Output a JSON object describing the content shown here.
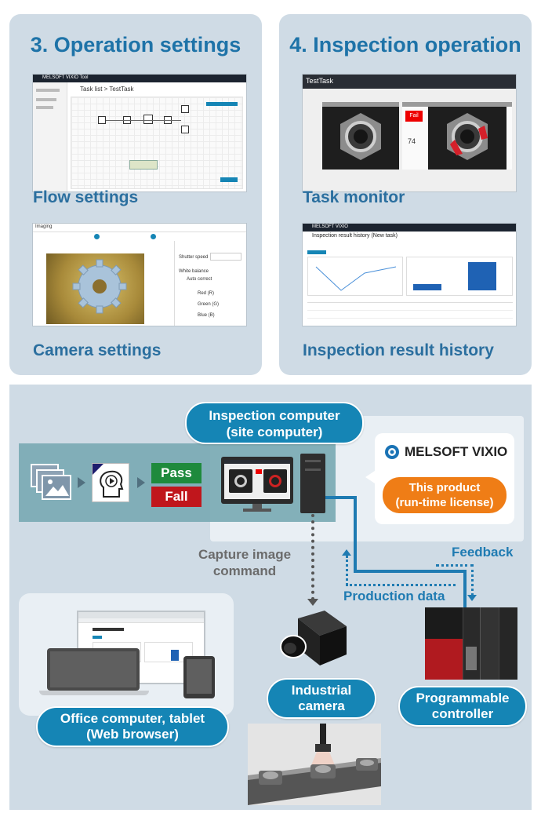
{
  "panels": {
    "operation_settings": {
      "title": "3. Operation settings",
      "flow_label": "Flow settings",
      "camera_label": "Camera settings",
      "flow_screen": {
        "app_name": "MELSOFT VIXIO Tool",
        "breadcrumb": "Task list  >  TestTask"
      },
      "camera_screen": {
        "title": "Imaging",
        "shutter_label": "Shutter speed",
        "white_balance": "White balance",
        "auto_correct": "Auto correct",
        "red": "Red (R)",
        "green": "Green (G)",
        "blue": "Blue (B)"
      }
    },
    "inspection_operation": {
      "title": "4. Inspection operation",
      "monitor_label": "Task monitor",
      "history_label": "Inspection result history",
      "monitor_screen": {
        "task_name": "TestTask",
        "fail_badge": "Fail",
        "score": "74"
      },
      "history_screen": {
        "app_name": "MELSOFT VIXIO",
        "title": "Inspection result history (New task)"
      }
    }
  },
  "system": {
    "inspection_computer": "Inspection computer\n(site computer)",
    "pass": "Pass",
    "fail": "Fall",
    "brand": "MELSOFT VIXIO",
    "license": "This product\n(run-time license)",
    "capture_command": "Capture image\ncommand",
    "feedback": "Feedback",
    "production_data": "Production data",
    "industrial_camera": "Industrial\ncamera",
    "plc": "Programmable\ncontroller",
    "office": "Office computer, tablet\n(Web browser)"
  },
  "colors": {
    "panel_bg": "#cfdbe5",
    "accent_blue": "#1585b5",
    "title_blue": "#1e73a8",
    "pass_green": "#1e8a3c",
    "fail_red": "#c0161c",
    "license_orange": "#ef7d16"
  }
}
